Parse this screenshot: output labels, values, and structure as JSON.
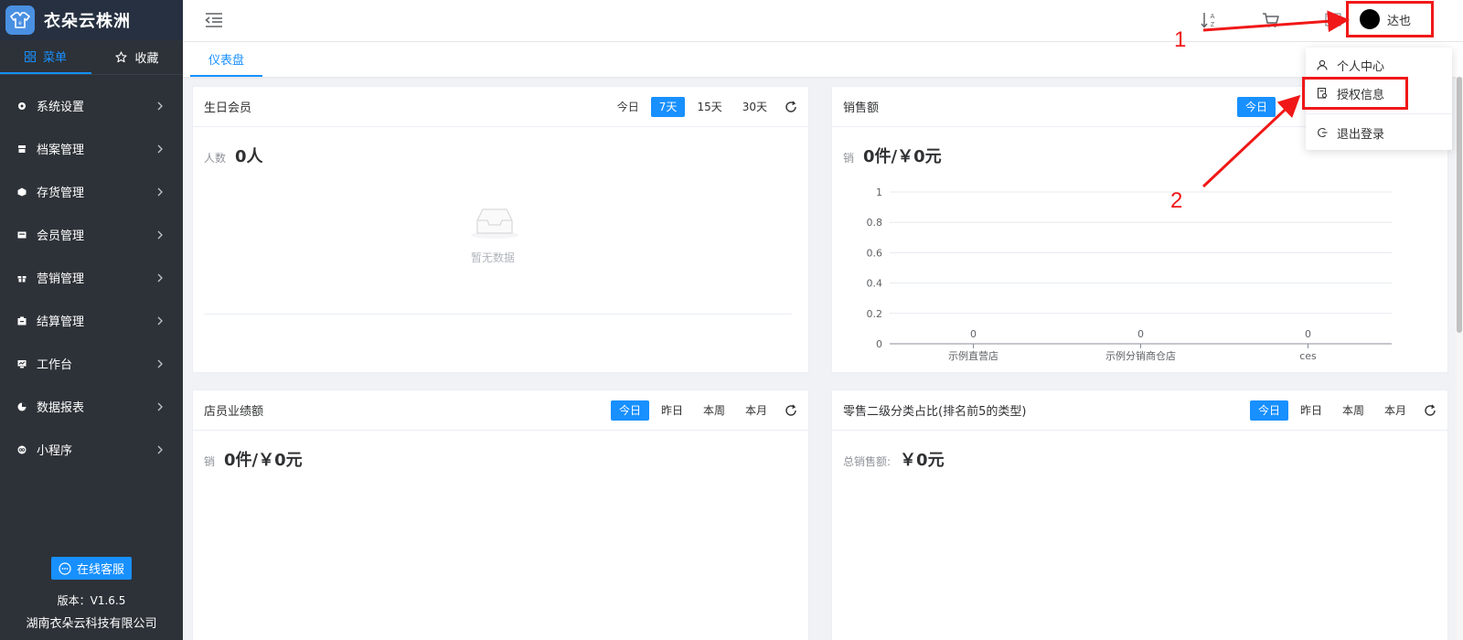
{
  "app": {
    "title": "衣朵云株洲"
  },
  "sidebar": {
    "tabs": [
      {
        "label": "菜单",
        "icon": "grid-icon",
        "active": true
      },
      {
        "label": "收藏",
        "icon": "star-icon",
        "active": false
      }
    ],
    "items": [
      {
        "label": "系统设置",
        "icon": "settings-icon"
      },
      {
        "label": "档案管理",
        "icon": "archive-icon"
      },
      {
        "label": "存货管理",
        "icon": "box-icon"
      },
      {
        "label": "会员管理",
        "icon": "member-card-icon"
      },
      {
        "label": "营销管理",
        "icon": "gift-icon"
      },
      {
        "label": "结算管理",
        "icon": "settlement-icon"
      },
      {
        "label": "工作台",
        "icon": "workbench-icon"
      },
      {
        "label": "数据报表",
        "icon": "pie-chart-icon"
      },
      {
        "label": "小程序",
        "icon": "mini-program-icon"
      }
    ],
    "service_button": "在线客服",
    "version": "版本：V1.6.5",
    "company": "湖南衣朵云科技有限公司"
  },
  "header": {
    "user_name": "达也",
    "icons": [
      "sort-az-icon",
      "cart-icon",
      "book-icon"
    ]
  },
  "page_tabs": {
    "active": "仪表盘"
  },
  "cards": {
    "birthday": {
      "title": "生日会员",
      "filters": [
        "今日",
        "7天",
        "15天",
        "30天"
      ],
      "active_filter": "7天",
      "metric_label": "人数",
      "metric_value": "0人",
      "empty_text": "暂无数据"
    },
    "sales": {
      "title": "销售额",
      "filters": [
        "今日"
      ],
      "active_filter": "今日",
      "metric_label": "销",
      "metric_value": "0件/￥0元"
    },
    "staff": {
      "title": "店员业绩额",
      "filters": [
        "今日",
        "昨日",
        "本周",
        "本月"
      ],
      "active_filter": "今日",
      "metric_label": "销",
      "metric_value": "0件/￥0元"
    },
    "category": {
      "title": "零售二级分类占比(排名前5的类型)",
      "filters": [
        "今日",
        "昨日",
        "本周",
        "本月"
      ],
      "active_filter": "今日",
      "metric_label": "总销售额:",
      "metric_value": "￥0元"
    }
  },
  "chart_data": {
    "type": "bar",
    "categories": [
      "示例直营店",
      "示例分销商仓店",
      "ces"
    ],
    "values": [
      0,
      0,
      0
    ],
    "data_labels": [
      "0",
      "0",
      "0"
    ],
    "yticks": [
      "0",
      "0.2",
      "0.4",
      "0.6",
      "0.8",
      "1"
    ],
    "ylim": [
      0,
      1
    ],
    "grid": true,
    "title": "",
    "xlabel": "",
    "ylabel": ""
  },
  "dropdown": {
    "items": [
      {
        "label": "个人中心",
        "icon": "user-icon"
      },
      {
        "label": "授权信息",
        "icon": "license-icon"
      },
      {
        "label": "退出登录",
        "icon": "logout-icon"
      }
    ]
  },
  "annotations": {
    "step1": "1",
    "step2": "2",
    "color": "#f01818"
  },
  "colors": {
    "accent": "#1890ff",
    "sidebar_bg": "#2d3238",
    "annotation": "#f01818"
  }
}
